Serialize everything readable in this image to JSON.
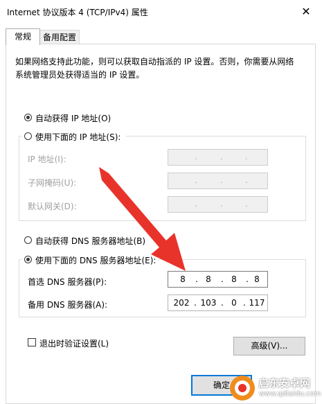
{
  "window": {
    "title": "Internet 协议版本 4 (TCP/IPv4) 属性",
    "close_glyph": "✕"
  },
  "tabs": [
    {
      "label": "常规",
      "selected": true
    },
    {
      "label": "备用配置",
      "selected": false
    }
  ],
  "description": "如果网络支持此功能，则可以获取自动指派的 IP 设置。否则，你需要从网络系统管理员处获得适当的 IP 设置。",
  "ip_section": {
    "auto_label": "自动获得 IP 地址(O)",
    "auto_selected": true,
    "manual_label": "使用下面的 IP 地址(S):",
    "manual_selected": false,
    "fields": [
      {
        "label": "IP 地址(I):",
        "value": ""
      },
      {
        "label": "子网掩码(U):",
        "value": ""
      },
      {
        "label": "默认网关(D):",
        "value": ""
      }
    ]
  },
  "dns_section": {
    "auto_label": "自动获得 DNS 服务器地址(B)",
    "auto_selected": false,
    "manual_label": "使用下面的 DNS 服务器地址(E):",
    "manual_selected": true,
    "preferred": {
      "label": "首选 DNS 服务器(P):",
      "octets": [
        "8",
        "8",
        "8",
        "8"
      ]
    },
    "alternate": {
      "label": "备用 DNS 服务器(A):",
      "octets": [
        "202",
        "103",
        "0",
        "117"
      ]
    }
  },
  "validate_on_exit": {
    "label": "退出时验证设置(L)",
    "checked": false
  },
  "buttons": {
    "advanced": "高级(V)...",
    "ok": "确定"
  },
  "watermark": {
    "brand": "启东安卓网",
    "url": "www.qdtaidu.com"
  },
  "colors": {
    "arrow": "#e8332a",
    "ok_border": "#0078d7"
  }
}
